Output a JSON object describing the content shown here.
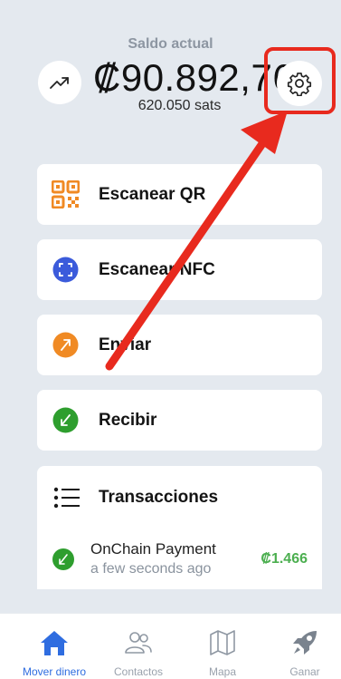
{
  "balance": {
    "label": "Saldo actual",
    "primary": "₡90.892,76",
    "secondary": "620.050 sats"
  },
  "actions": [
    {
      "label": "Escanear QR",
      "icon": "qr-code-icon",
      "color": "#f08a24"
    },
    {
      "label": "Escanear NFC",
      "icon": "nfc-scan-icon",
      "color": "#3b5bdb"
    },
    {
      "label": "Enviar",
      "icon": "send-icon",
      "color": "#f08a24"
    },
    {
      "label": "Recibir",
      "icon": "receive-icon",
      "color": "#2e9e2e"
    }
  ],
  "transactions": {
    "title": "Transacciones",
    "items": [
      {
        "name": "OnChain Payment",
        "time": "a few seconds ago",
        "amount": "₡1.466",
        "icon": "receive-icon"
      }
    ]
  },
  "nav": {
    "items": [
      {
        "label": "Mover dinero",
        "icon": "home-icon",
        "active": true
      },
      {
        "label": "Contactos",
        "icon": "contacts-icon",
        "active": false
      },
      {
        "label": "Mapa",
        "icon": "map-icon",
        "active": false
      },
      {
        "label": "Ganar",
        "icon": "rocket-icon",
        "active": false
      }
    ]
  },
  "colors": {
    "background": "#e4e9ef",
    "accent_blue": "#2f6de0",
    "positive_green": "#4caf50",
    "annotation_red": "#e82a1e"
  }
}
